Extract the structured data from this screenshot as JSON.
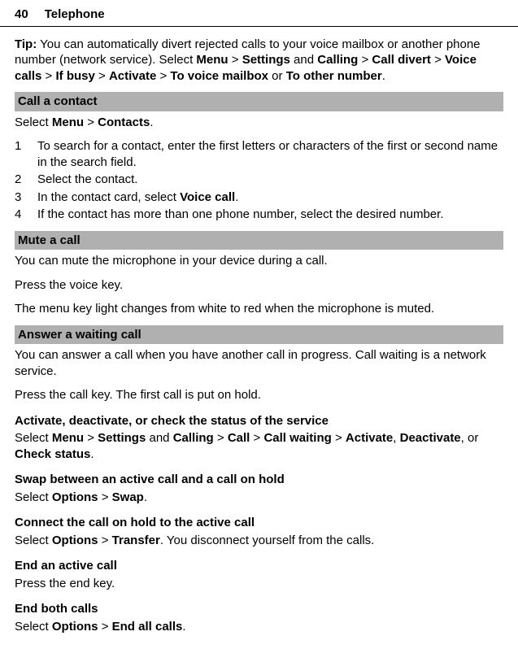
{
  "header": {
    "page_number": "40",
    "section": "Telephone"
  },
  "tip": {
    "label": "Tip:",
    "text_before": " You can automatically divert rejected calls to your voice mailbox or another phone number (network service). Select ",
    "menu": "Menu",
    "gt1": " > ",
    "settings": "Settings",
    "and1": " and ",
    "calling": "Calling",
    "gt2": " > ",
    "call_divert": "Call divert",
    "gt3": " > ",
    "voice_calls": "Voice calls",
    "gt4": " > ",
    "if_busy": "If busy",
    "gt5": " > ",
    "activate": "Activate",
    "gt6": " > ",
    "to_voice_mailbox": "To voice mailbox",
    "or": " or ",
    "to_other_number": "To other number",
    "period": "."
  },
  "call_contact": {
    "heading": "Call a contact",
    "select_text": "Select ",
    "menu": "Menu",
    "gt": " > ",
    "contacts": "Contacts",
    "period": ".",
    "steps": [
      {
        "n": "1",
        "text_a": "To search for a contact, enter the first letters or characters of the first or second name in the search field."
      },
      {
        "n": "2",
        "text_a": "Select the contact."
      },
      {
        "n": "3",
        "text_a": "In the contact card, select ",
        "bold": "Voice call",
        "text_b": "."
      },
      {
        "n": "4",
        "text_a": "If the contact has more than one phone number, select the desired number."
      }
    ]
  },
  "mute": {
    "heading": "Mute a call",
    "line1": "You can mute the microphone in your device during a call.",
    "line2": "Press the voice key.",
    "line3": "The menu key light changes from white to red when the microphone is muted."
  },
  "waiting": {
    "heading": "Answer a waiting call",
    "line1": "You can answer a call when you have another call in progress. Call waiting is a network service.",
    "line2": "Press the call key. The first call is put on hold.",
    "activate": {
      "heading": "Activate, deactivate, or check the status of the service",
      "select": "Select ",
      "menu": "Menu",
      "gt1": " > ",
      "settings": "Settings",
      "and": " and ",
      "calling": "Calling",
      "gt2": " > ",
      "call": "Call",
      "gt3": " > ",
      "call_waiting": "Call waiting",
      "gt4": " > ",
      "activate_opt": "Activate",
      "comma1": ", ",
      "deactivate": "Deactivate",
      "comma2": ", or ",
      "check_status": "Check status",
      "period": "."
    },
    "swap": {
      "heading": "Swap between an active call and a call on hold",
      "select": "Select ",
      "options": "Options",
      "gt": " > ",
      "swap_opt": "Swap",
      "period": "."
    },
    "connect": {
      "heading": "Connect the call on hold to the active call",
      "select": "Select ",
      "options": "Options",
      "gt": " > ",
      "transfer": "Transfer",
      "after": ". You disconnect yourself from the calls."
    },
    "end_active": {
      "heading": "End an active call",
      "text": "Press the end key."
    },
    "end_both": {
      "heading": "End both calls",
      "select": "Select ",
      "options": "Options",
      "gt": " > ",
      "end_all": "End all calls",
      "period": "."
    }
  }
}
